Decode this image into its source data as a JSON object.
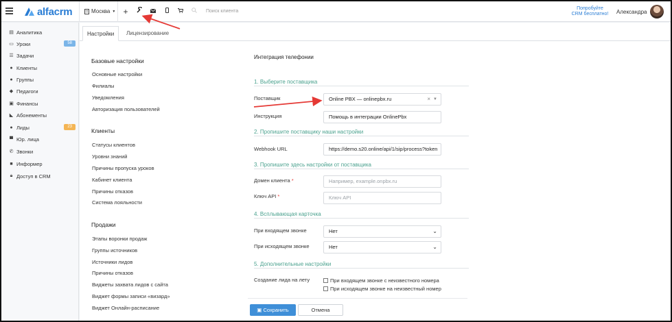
{
  "topbar": {
    "logo_text": "alfacrm",
    "city": "Москва",
    "search_placeholder": "Поиск клиента",
    "promo_line1": "Попробуйте",
    "promo_line2": "CRM бесплатно!",
    "user_name": "Александра"
  },
  "sidebar": {
    "items": [
      {
        "label": "Аналитика",
        "icon": "chart-icon"
      },
      {
        "label": "Уроки",
        "icon": "calendar-icon",
        "badge": "58"
      },
      {
        "label": "Задачи",
        "icon": "tasks-icon"
      },
      {
        "label": "Клиенты",
        "icon": "user-icon"
      },
      {
        "label": "Группы",
        "icon": "users-icon"
      },
      {
        "label": "Педагоги",
        "icon": "graduation-cap-icon"
      },
      {
        "label": "Финансы",
        "icon": "money-icon"
      },
      {
        "label": "Абонементы",
        "icon": "tag-icon"
      },
      {
        "label": "Лиды",
        "icon": "user-plus-icon",
        "badge": "23"
      },
      {
        "label": "Юр. лица",
        "icon": "building-icon"
      },
      {
        "label": "Звонки",
        "icon": "phone-icon"
      },
      {
        "label": "Информер",
        "icon": "informer-icon"
      },
      {
        "label": "Доступ в CRM",
        "icon": "lock-icon"
      }
    ]
  },
  "tabs": [
    "Настройки",
    "Лицензирование"
  ],
  "settings_nav": {
    "base_title": "Базовые настройки",
    "base_links": [
      "Основные настройки",
      "Филиалы",
      "Уведомления",
      "Авторизация пользователей"
    ],
    "clients_title": "Клиенты",
    "clients_links": [
      "Статусы клиентов",
      "Уровни знаний",
      "Причины пропуска уроков",
      "Кабинет клиента",
      "Причины отказов",
      "Система лояльности"
    ],
    "sales_title": "Продажи",
    "sales_links": [
      "Этапы воронки продаж",
      "Группы источников",
      "Источники лидов",
      "Причины отказов",
      "Виджеты захвата лидов с сайта",
      "Виджет формы записи «визард»",
      "Виджет Онлайн-расписание"
    ]
  },
  "panel": {
    "title": "Интеграция телефонии",
    "step1": "1. Выберите поставщика",
    "provider_label": "Поставщик",
    "provider_value": "Online PBX — onlinepbx.ru",
    "instruction_label": "Инструкция",
    "instruction_value": "Помощь в интеграции OnlinePbx",
    "step2": "2. Пропишите поставщику наши настройки",
    "webhook_label": "Webhook URL",
    "webhook_value": "https://demo.s20.online/api/1/sip/process?token",
    "step3": "3. Пропишите здесь настройки от поставщика",
    "domain_label": "Домен клиента",
    "domain_placeholder": "Например, example.onpbx.ru",
    "key_label": "Ключ API",
    "key_placeholder": "Ключ API",
    "step4": "4. Всплывающая карточка",
    "incoming_label": "При входящем звонке",
    "incoming_value": "Нет",
    "outgoing_label": "При исходящем звонке",
    "outgoing_value": "Нет",
    "step5": "5. Дополнительные настройки",
    "create_lead_label": "Создание лида на лету",
    "cb_incoming": "При входящем звонке с неизвестного номера",
    "cb_outgoing": "При исходящем звонке на неизвестный номер",
    "required_mark": "*"
  },
  "buttons": {
    "save": "Сохранить",
    "cancel": "Отмена"
  },
  "colors": {
    "brand": "#2a7dd4",
    "accent_green": "#4aa18e",
    "annotation_red": "#e53935"
  }
}
